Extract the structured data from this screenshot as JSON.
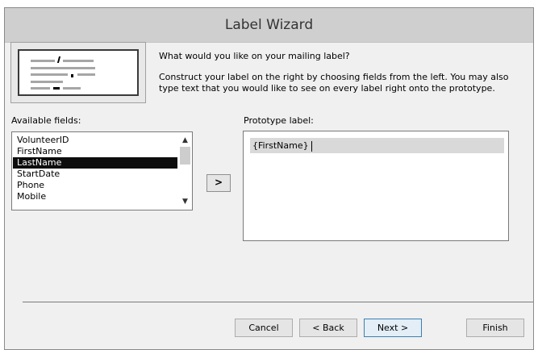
{
  "window": {
    "title": "Label Wizard"
  },
  "instructions": {
    "question": "What would you like on your mailing label?",
    "detail": "Construct your label on the right by choosing fields from the left. You may also type text that you would like to see on every label right onto the prototype."
  },
  "available_fields": {
    "label": "Available fields:",
    "items": [
      {
        "label": "VolunteerID",
        "selected": false
      },
      {
        "label": "FirstName",
        "selected": false
      },
      {
        "label": "LastName",
        "selected": true
      },
      {
        "label": "StartDate",
        "selected": false
      },
      {
        "label": "Phone",
        "selected": false
      },
      {
        "label": "Mobile",
        "selected": false
      }
    ],
    "scroll_up_icon": "chevron-up-icon",
    "scroll_down_icon": "chevron-down-icon"
  },
  "move_button": {
    "label": ">"
  },
  "prototype": {
    "label": "Prototype label:",
    "line1": "{FirstName}"
  },
  "buttons": {
    "cancel": "Cancel",
    "back": "< Back",
    "next": "Next >",
    "finish": "Finish"
  },
  "colors": {
    "titlebar": "#cfcfcf",
    "dialog_bg": "#f0f0f0",
    "selection": "#0d0d0d",
    "default_button_border": "#3c7fb1"
  }
}
